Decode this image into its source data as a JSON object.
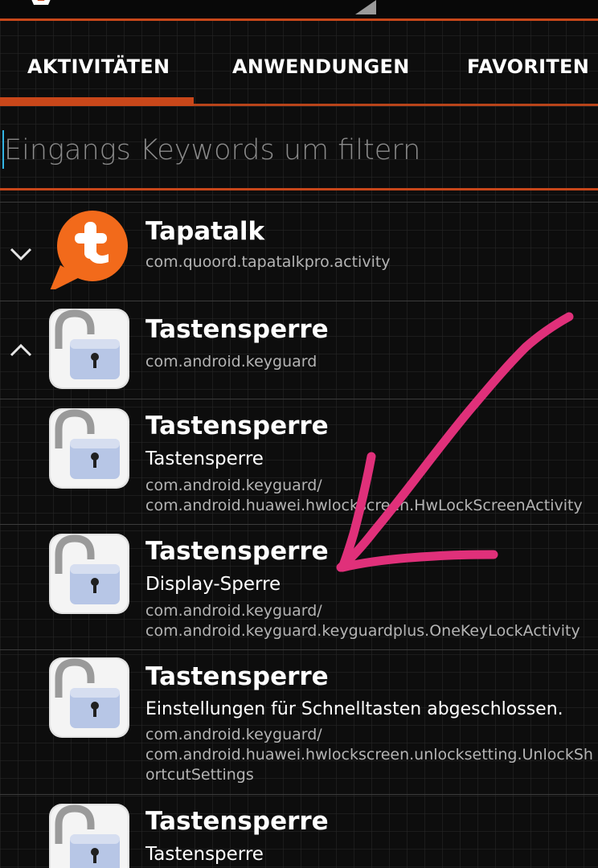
{
  "tabs": [
    {
      "label": "AKTIVITÄTEN",
      "selected": true
    },
    {
      "label": "ANWENDUNGEN",
      "selected": false
    },
    {
      "label": "FAVORITEN",
      "selected": false
    }
  ],
  "search": {
    "placeholder": "Eingangs Keywords um filtern",
    "value": ""
  },
  "list": [
    {
      "chevron": "chevron-down-icon",
      "icon": "tapatalk-icon",
      "title": "Tapatalk",
      "subtitle": "",
      "package_line1": "com.quoord.tapatalkpro.activity",
      "package_line2": "",
      "package_line3": ""
    },
    {
      "chevron": "chevron-up-icon",
      "icon": "padlock-icon",
      "title": "Tastensperre",
      "subtitle": "",
      "package_line1": "com.android.keyguard",
      "package_line2": "",
      "package_line3": ""
    },
    {
      "chevron": "",
      "icon": "padlock-icon",
      "title": "Tastensperre",
      "subtitle": "Tastensperre",
      "package_line1": "com.android.keyguard/",
      "package_line2": "com.android.huawei.hwlockscreen.HwLockScreenActivity",
      "package_line3": ""
    },
    {
      "chevron": "",
      "icon": "padlock-icon",
      "title": "Tastensperre",
      "subtitle": "Display-Sperre",
      "package_line1": "com.android.keyguard/",
      "package_line2": "com.android.keyguard.keyguardplus.OneKeyLockActivity",
      "package_line3": ""
    },
    {
      "chevron": "",
      "icon": "padlock-icon",
      "title": "Tastensperre",
      "subtitle": "Einstellungen für Schnelltasten abgeschlossen.",
      "package_line1": "com.android.keyguard/",
      "package_line2": "com.android.huawei.hwlockscreen.unlocksetting.UnlockSh",
      "package_line3": "ortcutSettings"
    },
    {
      "chevron": "",
      "icon": "padlock-icon",
      "title": "Tastensperre",
      "subtitle": "Tastensperre",
      "package_line1": "",
      "package_line2": "",
      "package_line3": ""
    }
  ],
  "colors": {
    "accent": "#c8471a",
    "annotation": "#e0307a",
    "tapatalk": "#f26a1b"
  },
  "annotation": {
    "type": "hand-drawn-arrow",
    "color": "#e0307a",
    "points_to": "list.3"
  }
}
